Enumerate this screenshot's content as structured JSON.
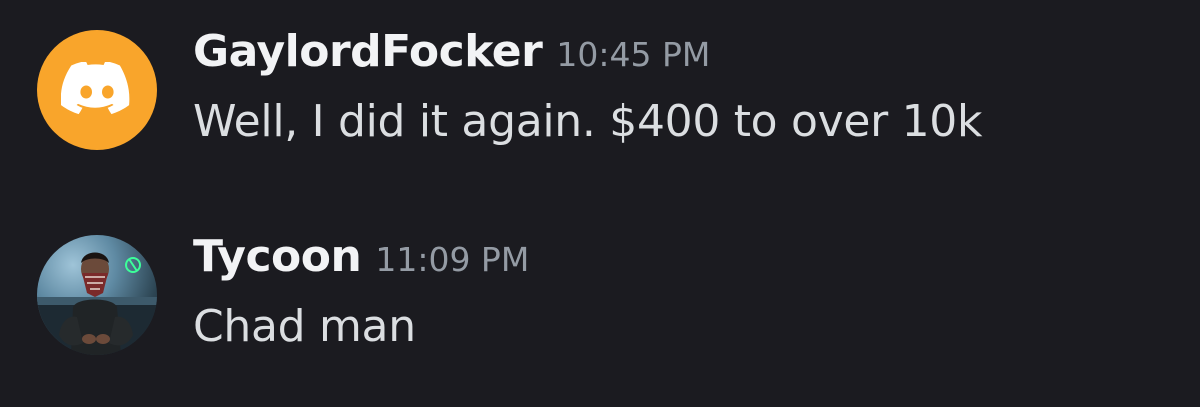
{
  "messages": [
    {
      "username": "GaylordFocker",
      "timestamp": "10:45 PM",
      "text": "Well, I did it again. $400 to over 10k",
      "avatar": {
        "type": "discord-default-logo",
        "color": "#f9a52b"
      }
    },
    {
      "username": "Tycoon",
      "timestamp": "11:09 PM",
      "text": "Chad man",
      "avatar": {
        "type": "photo-person-with-bandana"
      }
    }
  ],
  "colors": {
    "background": "#1b1b20",
    "username": "#f2f3f5",
    "timestamp": "#949ba4",
    "message_text": "#dbdee1"
  }
}
